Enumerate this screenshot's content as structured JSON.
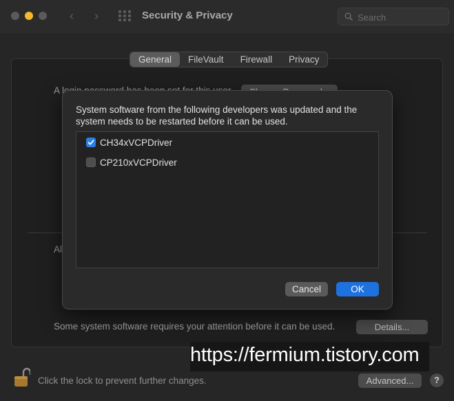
{
  "window": {
    "title": "Security & Privacy",
    "search_placeholder": "Search"
  },
  "tabs": [
    {
      "label": "General",
      "active": true
    },
    {
      "label": "FileVault",
      "active": false
    },
    {
      "label": "Firewall",
      "active": false
    },
    {
      "label": "Privacy",
      "active": false
    }
  ],
  "background": {
    "password_text_partial": "A login password has been set for this user",
    "change_password_button": "Change Password...",
    "allow_text_partial": "Al",
    "attention_text": "Some system software requires your attention before it can be used.",
    "details_button": "Details..."
  },
  "bottom": {
    "lock_text": "Click the lock to prevent further changes.",
    "advanced_button": "Advanced...",
    "help_button": "?"
  },
  "sheet": {
    "message": "System software from the following developers was updated and the system needs to be restarted before it can be used.",
    "items": [
      {
        "label": "CH34xVCPDriver",
        "checked": true
      },
      {
        "label": "CP210xVCPDriver",
        "checked": false
      }
    ],
    "cancel_button": "Cancel",
    "ok_button": "OK"
  },
  "watermark": "https://fermium.tistory.com",
  "colors": {
    "accent": "#1e72e0",
    "checkbox_checked": "#2b7fe6",
    "minimize_light": "#f5b82e"
  }
}
